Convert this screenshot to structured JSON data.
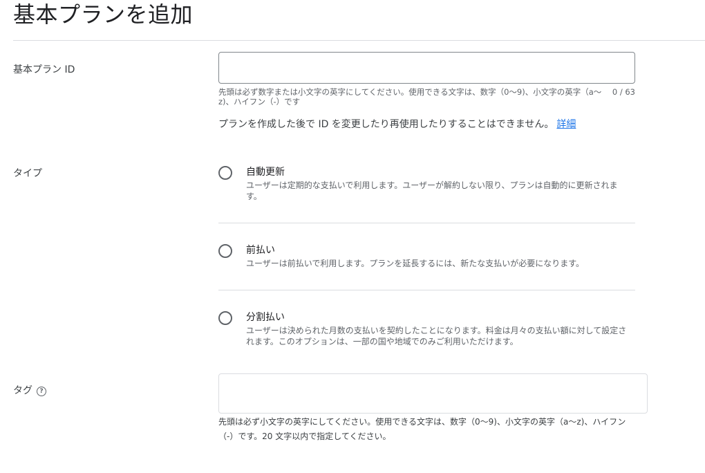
{
  "page": {
    "title": "基本プランを追加"
  },
  "plan_id": {
    "label": "基本プラン ID",
    "value": "",
    "helper": "先頭は必ず数字または小文字の英字にしてください。使用できる文字は、数字（0〜9)、小文字の英字（a〜z)、ハイフン（-）です",
    "counter": "0 / 63",
    "notice": "プランを作成した後で ID を変更したり再使用したりすることはできません。",
    "notice_link": "詳細"
  },
  "type": {
    "label": "タイプ",
    "options": [
      {
        "title": "自動更新",
        "description": "ユーザーは定期的な支払いで利用します。ユーザーが解約しない限り、プランは自動的に更新されます。"
      },
      {
        "title": "前払い",
        "description": "ユーザーは前払いで利用します。プランを延長するには、新たな支払いが必要になります。"
      },
      {
        "title": "分割払い",
        "description": "ユーザーは決められた月数の支払いを契約したことになります。料金は月々の支払い額に対して設定されます。このオプションは、一部の国や地域でのみご利用いただけます。"
      }
    ]
  },
  "tag": {
    "label": "タグ",
    "help_icon_glyph": "?",
    "value": "",
    "helper": "先頭は必ず小文字の英字にしてください。使用できる文字は、数字（0〜9)、小文字の英字（a〜z)、ハイフン（-）です。20 文字以内で指定してください。"
  }
}
